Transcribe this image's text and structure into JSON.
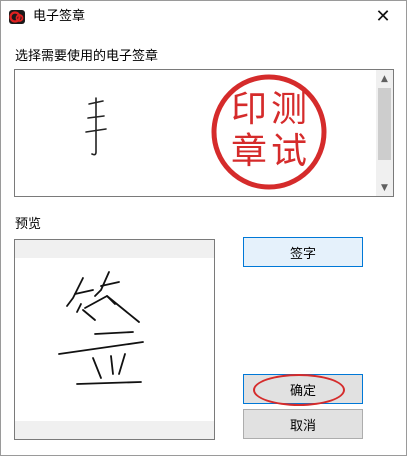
{
  "window": {
    "title": "电子签章",
    "app_icon": "seal-app-icon",
    "close_glyph": "✕"
  },
  "colors": {
    "seal_red": "#d52b2b",
    "button_border_accent": "#0078d7"
  },
  "signature_list": {
    "label": "选择需要使用的电子签章",
    "items": [
      {
        "type": "handwritten",
        "icon": "handwritten-signature-shou"
      },
      {
        "type": "stamp",
        "stamp_text": [
          "印",
          "测",
          "章",
          "试"
        ]
      }
    ],
    "scroll_up_glyph": "▲",
    "scroll_down_glyph": "▼"
  },
  "preview": {
    "label": "预览",
    "icon": "handwritten-signature-qian"
  },
  "buttons": {
    "sign": "签字",
    "confirm": "确定",
    "cancel": "取消"
  }
}
